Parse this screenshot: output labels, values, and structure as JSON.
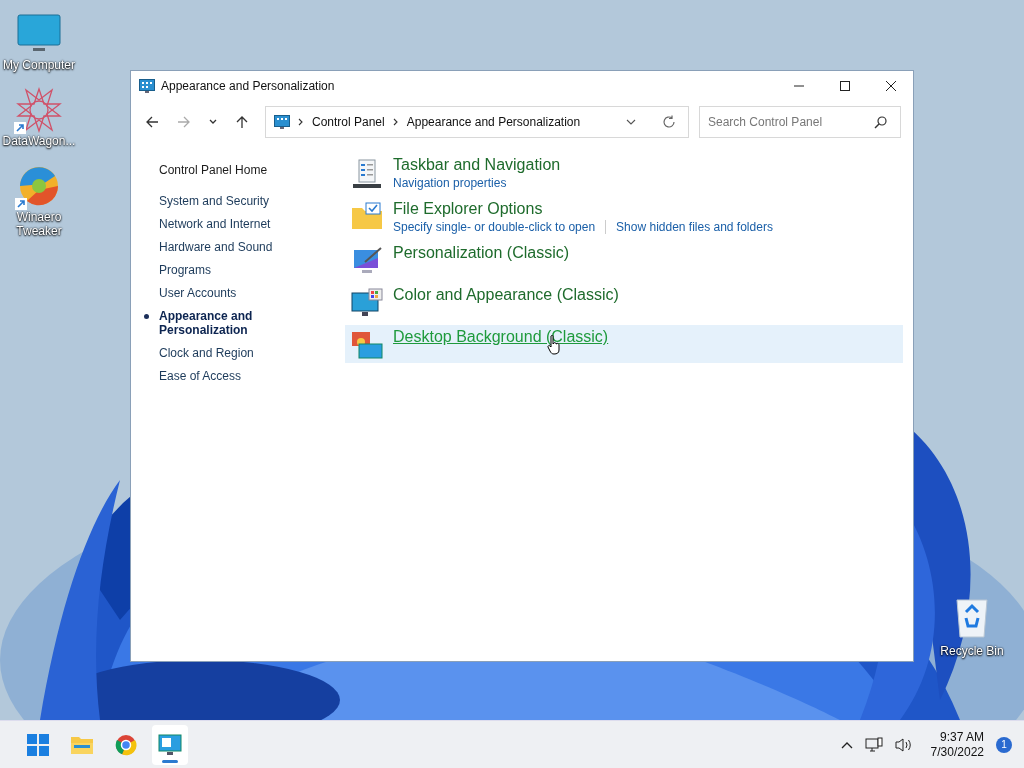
{
  "desktop_icons": [
    {
      "label": "My Computer",
      "kind": "monitor",
      "shortcut": false
    },
    {
      "label": "DataWagon...",
      "kind": "star",
      "shortcut": true
    },
    {
      "label": "Winaero Tweaker",
      "kind": "swirl",
      "shortcut": true
    }
  ],
  "recycle_bin": {
    "label": "Recycle Bin"
  },
  "window": {
    "title": "Appearance and Personalization",
    "nav_buttons": [
      {
        "kind": "back",
        "disabled": false
      },
      {
        "kind": "forward",
        "disabled": true
      },
      {
        "kind": "recent",
        "disabled": false
      },
      {
        "kind": "up",
        "disabled": false
      }
    ],
    "address_path": [
      "Control Panel",
      "Appearance and Personalization"
    ],
    "search": {
      "placeholder": "Search Control Panel"
    },
    "sidebar": {
      "home": "Control Panel Home",
      "items": [
        {
          "label": "System and Security",
          "selected": false
        },
        {
          "label": "Network and Internet",
          "selected": false
        },
        {
          "label": "Hardware and Sound",
          "selected": false
        },
        {
          "label": "Programs",
          "selected": false
        },
        {
          "label": "User Accounts",
          "selected": false
        },
        {
          "label": "Appearance and Personalization",
          "selected": true
        },
        {
          "label": "Clock and Region",
          "selected": false
        },
        {
          "label": "Ease of Access",
          "selected": false
        }
      ]
    },
    "categories": [
      {
        "kind": "taskbar",
        "title": "Taskbar and Navigation",
        "links": [
          "Navigation properties"
        ],
        "hovered": false
      },
      {
        "kind": "folder",
        "title": "File Explorer Options",
        "links": [
          "Specify single- or double-click to open",
          "Show hidden files and folders"
        ],
        "hovered": false
      },
      {
        "kind": "personalization",
        "title": "Personalization (Classic)",
        "hovered": false
      },
      {
        "kind": "color",
        "title": "Color and Appearance (Classic)",
        "hovered": false
      },
      {
        "kind": "desktop",
        "title": "Desktop Background (Classic)",
        "hovered": true
      }
    ]
  },
  "taskbar": {
    "apps": [
      {
        "kind": "start",
        "active": false
      },
      {
        "kind": "explorer",
        "active": false
      },
      {
        "kind": "browser",
        "active": false
      },
      {
        "kind": "control-panel",
        "active": true
      }
    ],
    "time": "9:37 AM",
    "date": "7/30/2022",
    "notification_count": "1"
  }
}
